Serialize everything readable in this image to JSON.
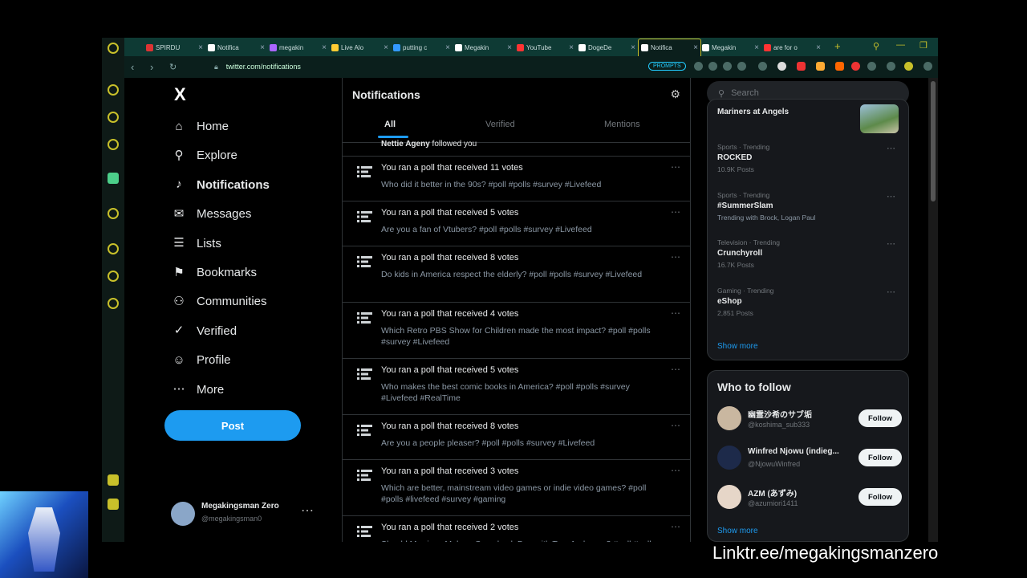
{
  "browser": {
    "tabs": [
      {
        "label": "SPIRDU",
        "color": "#d33"
      },
      {
        "label": "Notifica",
        "color": "#fff"
      },
      {
        "label": "megakin",
        "color": "#a6f"
      },
      {
        "label": "Live Alo",
        "color": "#fc3"
      },
      {
        "label": "putting c",
        "color": "#39f"
      },
      {
        "label": "Megakin",
        "color": "#fff"
      },
      {
        "label": "YouTube",
        "color": "#f33"
      },
      {
        "label": "DogeDe",
        "color": "#fff"
      },
      {
        "label": "Notifica",
        "color": "#fff"
      },
      {
        "label": "Megakin",
        "color": "#fff"
      },
      {
        "label": "are for o",
        "color": "#f33"
      }
    ],
    "url": "twitter.com/notifications",
    "badge": "PROMPTS"
  },
  "nav": {
    "items": [
      {
        "label": "Home",
        "icon": "home-icon",
        "glyph": "⌂"
      },
      {
        "label": "Explore",
        "icon": "search-icon",
        "glyph": "⚲"
      },
      {
        "label": "Notifications",
        "icon": "bell-icon",
        "glyph": "♪"
      },
      {
        "label": "Messages",
        "icon": "mail-icon",
        "glyph": "✉"
      },
      {
        "label": "Lists",
        "icon": "list-icon",
        "glyph": "☰"
      },
      {
        "label": "Bookmarks",
        "icon": "bookmark-icon",
        "glyph": "⚑"
      },
      {
        "label": "Communities",
        "icon": "communities-icon",
        "glyph": "⚇"
      },
      {
        "label": "Verified",
        "icon": "verified-icon",
        "glyph": "✓"
      },
      {
        "label": "Profile",
        "icon": "profile-icon",
        "glyph": "☺"
      },
      {
        "label": "More",
        "icon": "more-icon",
        "glyph": "⋯"
      }
    ],
    "post_label": "Post",
    "profile": {
      "name": "Megakingsman Zero",
      "handle": "@megakingsman0"
    }
  },
  "feed": {
    "title": "Notifications",
    "tabs": [
      "All",
      "Verified",
      "Mentions"
    ],
    "top_snippet": {
      "name": "Nettie Ageny",
      "text": " followed you"
    },
    "items": [
      {
        "title": "You ran a poll that received 11 votes",
        "text": "Who did it better in the 90s? #poll #polls #survey #Livefeed"
      },
      {
        "title": "You ran a poll that received 5 votes",
        "text": "Are you a fan of Vtubers? #poll #polls #survey #Livefeed"
      },
      {
        "title": "You ran a poll that received 8 votes",
        "text": "Do kids in America respect the elderly? #poll #polls #survey #Livefeed"
      },
      {
        "title": "You ran a poll that received 4 votes",
        "text": "Which Retro PBS Show for Children made the most impact? #poll #polls #survey #Livefeed"
      },
      {
        "title": "You ran a poll that received 5 votes",
        "text": "Who makes the best comic books in America? #poll #polls #survey #Livefeed #RealTime"
      },
      {
        "title": "You ran a poll that received 8 votes",
        "text": "Are you a people pleaser? #poll #polls #survey #Livefeed"
      },
      {
        "title": "You ran a poll that received 3 votes",
        "text": "Which are better, mainstream video games or indie video games? #poll #polls #livefeed #survey #gaming"
      },
      {
        "title": "You ran a poll that received 2 votes",
        "text": "Should Morrison Make a Comeback Duo with Tom Anderson? #poll #polls"
      }
    ]
  },
  "right": {
    "search_placeholder": "Search",
    "top_trend": "Mariners at Angels",
    "trends": [
      {
        "meta": "Sports · Trending",
        "name": "ROCKED",
        "count": "10.9K Posts"
      },
      {
        "meta": "Sports · Trending",
        "name": "#SummerSlam",
        "count": "Trending with Brock, Logan Paul"
      },
      {
        "meta": "Television · Trending",
        "name": "Crunchyroll",
        "count": "16.7K Posts"
      },
      {
        "meta": "Gaming · Trending",
        "name": "eShop",
        "count": "2,851 Posts"
      }
    ],
    "show_more": "Show more",
    "who_to_follow_title": "Who to follow",
    "follow": [
      {
        "name": "幽霊沙希のサブ垢",
        "handle": "@koshima_sub333",
        "avatar_color": "#c9b7a0"
      },
      {
        "name": "Winfred Njowu (indieg...",
        "handle": "@NjowuWinfred",
        "avatar_color": "#1d2a4a"
      },
      {
        "name": "AZM (あずみ)",
        "handle": "@azumiori1411",
        "avatar_color": "#e6d6c8"
      }
    ],
    "follow_label": "Follow",
    "show_more_2": "Show more"
  },
  "overlay": {
    "linktree": "Linktr.ee/megakingsmanzero"
  }
}
